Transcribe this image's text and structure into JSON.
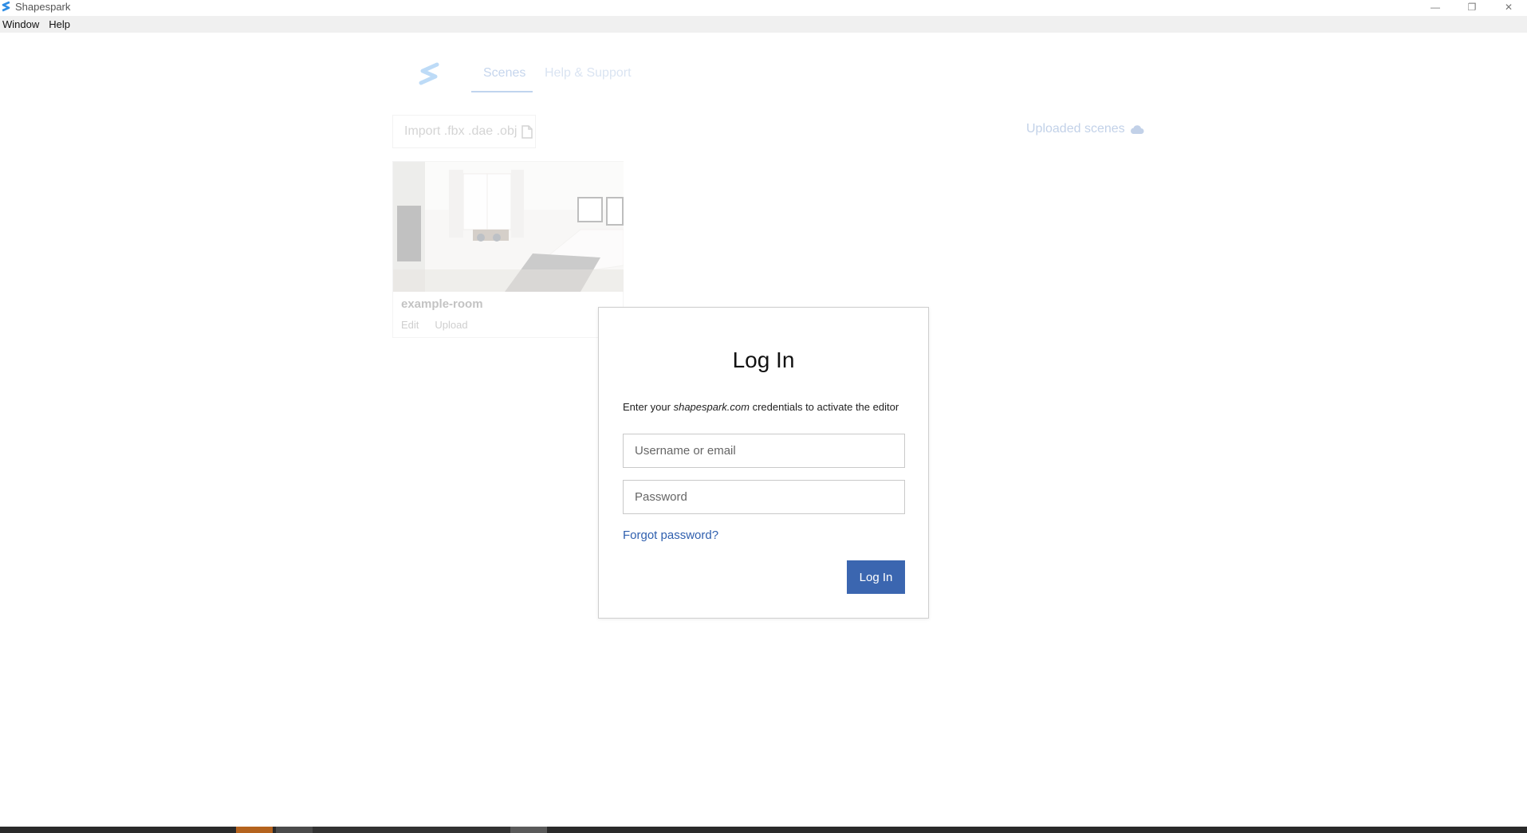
{
  "window": {
    "title": "Shapespark",
    "controls": {
      "minimize": "—",
      "maximize": "❐",
      "close": "✕"
    }
  },
  "menubar": {
    "items": [
      {
        "label": "Window"
      },
      {
        "label": "Help"
      }
    ]
  },
  "app": {
    "nav": {
      "tabs": [
        {
          "label": "Scenes",
          "active": true
        },
        {
          "label": "Help & Support",
          "active": false
        }
      ]
    },
    "import_label": "Import .fbx .dae .obj",
    "uploaded_label": "Uploaded scenes",
    "scenes": [
      {
        "name": "example-room",
        "actions": [
          "Edit",
          "Upload"
        ]
      }
    ]
  },
  "login_modal": {
    "title": "Log In",
    "description_prefix": "Enter your ",
    "description_domain": "shapespark.com",
    "description_suffix": " credentials to activate the editor",
    "username_placeholder": "Username or email",
    "username_value": "",
    "password_placeholder": "Password",
    "password_value": "",
    "forgot_label": "Forgot password?",
    "submit_label": "Log In"
  },
  "colors": {
    "accent": "#3b66b0",
    "link": "#2f5fae",
    "menubar_bg": "#f0f0f0",
    "taskbar_bg": "#2a2a2a"
  }
}
